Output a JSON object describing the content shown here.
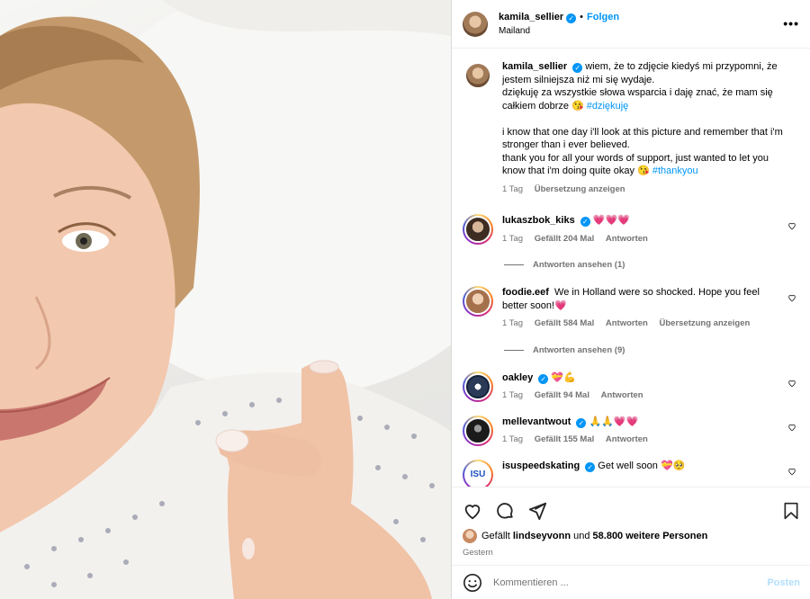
{
  "post": {
    "author": "kamila_sellier",
    "follow_label": "Folgen",
    "separator": "•",
    "location": "Mailand",
    "more_label": "•••"
  },
  "caption": {
    "author": "kamila_sellier",
    "lines_pl": "wiem, że to zdjęcie kiedyś mi przypomni, że jestem silniejsza niż mi się wydaje.",
    "lines_pl2": "dziękuję za wszystkie słowa wsparcia i daję znać, że mam się całkiem dobrze 😘",
    "hashtag_pl": "#dziękuję",
    "lines_en": "i know that one day i'll look at this picture and remember that i'm stronger than i ever believed.",
    "lines_en2": "thank you for all your words of support, just wanted to let you know that i'm doing quite okay 😘",
    "hashtag_en": "#thankyou",
    "time": "1 Tag",
    "translate": "Übersetzung anzeigen"
  },
  "comments": [
    {
      "user": "lukaszbok_kiks",
      "text": "💗💗💗",
      "time": "1 Tag",
      "likes": "Gefällt 204 Mal",
      "reply": "Antworten",
      "view_replies": "Antworten ansehen (1)"
    },
    {
      "user": "foodie.eef",
      "text": "We in Holland were so shocked. Hope you feel better soon!💗",
      "time": "1 Tag",
      "likes": "Gefällt 584 Mal",
      "reply": "Antworten",
      "translate": "Übersetzung anzeigen",
      "view_replies": "Antworten ansehen (9)"
    },
    {
      "user": "oakley",
      "text": "💝💪",
      "time": "1 Tag",
      "likes": "Gefällt 94 Mal",
      "reply": "Antworten"
    },
    {
      "user": "mellevantwout",
      "text": "🙏🙏💗💗",
      "time": "1 Tag",
      "likes": "Gefällt 155 Mal",
      "reply": "Antworten"
    },
    {
      "user": "isuspeedskating",
      "text": "Get well soon 💝🥺"
    }
  ],
  "footer": {
    "liked_by_prefix": "Gefällt",
    "liked_by_user": "lindseyvonn",
    "liked_by_mid": "und",
    "liked_by_count": "58.800 weitere Personen",
    "date": "Gestern",
    "comment_placeholder": "Kommentieren ...",
    "post_label": "Posten"
  },
  "colors": {
    "accent": "#0095f6",
    "heart": "#ed4956",
    "muted": "#737373"
  }
}
